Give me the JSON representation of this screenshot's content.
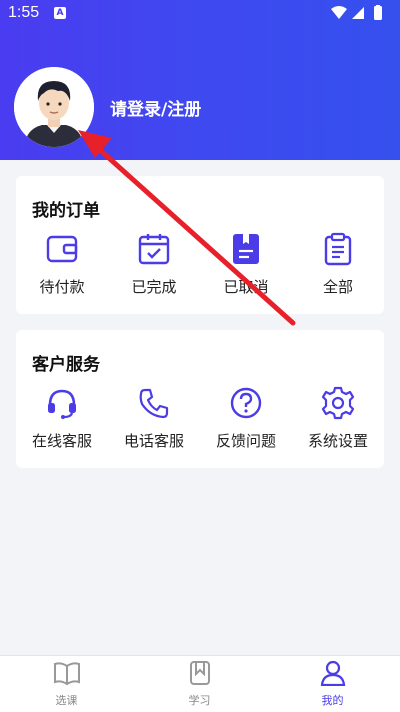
{
  "status": {
    "time": "1:55",
    "notif": "A"
  },
  "profile": {
    "login_label": "请登录/注册"
  },
  "orders": {
    "title": "我的订单",
    "items": [
      {
        "label": "待付款",
        "icon": "wallet-icon"
      },
      {
        "label": "已完成",
        "icon": "calendar-check-icon"
      },
      {
        "label": "已取消",
        "icon": "bookmark-doc-icon"
      },
      {
        "label": "全部",
        "icon": "clipboard-icon"
      }
    ]
  },
  "services": {
    "title": "客户服务",
    "items": [
      {
        "label": "在线客服",
        "icon": "headset-icon"
      },
      {
        "label": "电话客服",
        "icon": "phone-icon"
      },
      {
        "label": "反馈问题",
        "icon": "question-icon"
      },
      {
        "label": "系统设置",
        "icon": "gear-icon"
      }
    ]
  },
  "tabs": [
    {
      "label": "选课",
      "icon": "book-icon",
      "active": false
    },
    {
      "label": "学习",
      "icon": "study-icon",
      "active": false
    },
    {
      "label": "我的",
      "icon": "person-icon",
      "active": true
    }
  ],
  "colors": {
    "accent": "#4b3ce8",
    "header_start": "#4a3cf0",
    "header_end": "#3550ee",
    "annotation": "#e8202a"
  }
}
